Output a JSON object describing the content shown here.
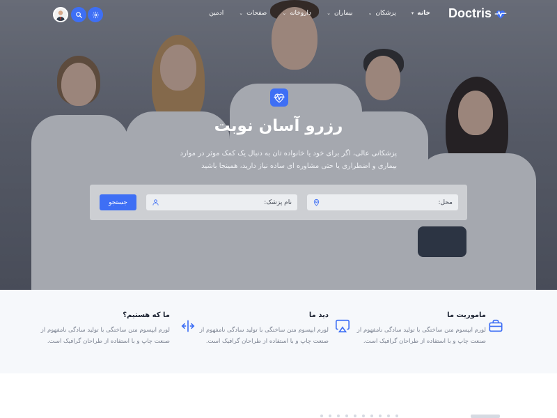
{
  "brand": {
    "name": "Doctris",
    "accent": "#3e6ff5"
  },
  "nav": {
    "items": [
      {
        "label": "خانه",
        "active": true,
        "has_dropdown": true
      },
      {
        "label": "پزشکان",
        "active": false,
        "has_dropdown": true
      },
      {
        "label": "بیماران",
        "active": false,
        "has_dropdown": true
      },
      {
        "label": "داروخانه",
        "active": false,
        "has_dropdown": true
      },
      {
        "label": "صفحات",
        "active": false,
        "has_dropdown": true
      },
      {
        "label": "ادمین",
        "active": false,
        "has_dropdown": false
      }
    ],
    "icons": [
      "settings-icon",
      "search-icon",
      "user-avatar"
    ]
  },
  "hero": {
    "title": "رزرو آسان نوبت",
    "description": "پزشکانی عالی، اگر برای خود یا خانواده تان به دنبال یک کمک موثر در موارد بیماری و اضطراری یا حتی مشاوره ای ساده نیاز دارید، همینجا باشید",
    "search": {
      "location_placeholder": "محل:",
      "doctor_placeholder": "نام پزشک:",
      "button_label": "جستجو"
    }
  },
  "features": [
    {
      "title": "ماموریت ما",
      "text": "لورم ایپسوم متن ساختگی با تولید سادگی نامفهوم از صنعت چاپ و با استفاده از طراحان گرافیک است.",
      "icon": "briefcase-icon"
    },
    {
      "title": "دید ما",
      "text": "لورم ایپسوم متن ساختگی با تولید سادگی نامفهوم از صنعت چاپ و با استفاده از طراحان گرافیک است.",
      "icon": "airplay-icon"
    },
    {
      "title": "ما که هستیم؟",
      "text": "لورم ایپسوم متن ساختگی با تولید سادگی نامفهوم از صنعت چاپ و با استفاده از طراحان گرافیک است.",
      "icon": "split-arrows-icon"
    }
  ]
}
